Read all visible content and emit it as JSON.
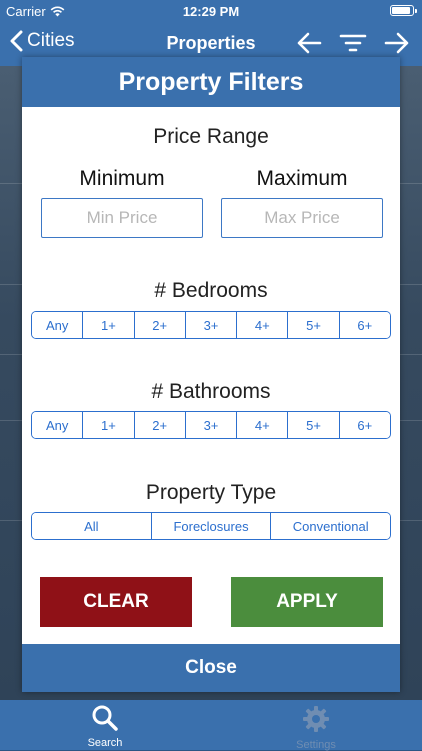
{
  "status_bar": {
    "carrier": "Carrier",
    "time": "12:29 PM"
  },
  "nav": {
    "back_label": "Cities",
    "title": "Properties",
    "icons": [
      "arrow-left-icon",
      "filter-icon",
      "arrow-right-icon"
    ]
  },
  "modal": {
    "title": "Property Filters",
    "price": {
      "section_title": "Price Range",
      "min_label": "Minimum",
      "max_label": "Maximum",
      "min_placeholder": "Min Price",
      "max_placeholder": "Max Price",
      "min_value": "",
      "max_value": ""
    },
    "bedrooms": {
      "section_title": "# Bedrooms",
      "options": [
        "Any",
        "1+",
        "2+",
        "3+",
        "4+",
        "5+",
        "6+"
      ]
    },
    "bathrooms": {
      "section_title": "# Bathrooms",
      "options": [
        "Any",
        "1+",
        "2+",
        "3+",
        "4+",
        "5+",
        "6+"
      ]
    },
    "property_type": {
      "section_title": "Property Type",
      "options": [
        "All",
        "Foreclosures",
        "Conventional"
      ]
    },
    "clear_label": "CLEAR",
    "apply_label": "APPLY",
    "close_label": "Close"
  },
  "tab_bar": {
    "search_label": "Search",
    "settings_label": "Settings"
  },
  "colors": {
    "header_blue": "#3a70ad",
    "segment_blue": "#2c6fce",
    "clear_red": "#8f1117",
    "apply_green": "#4b8d3d"
  }
}
